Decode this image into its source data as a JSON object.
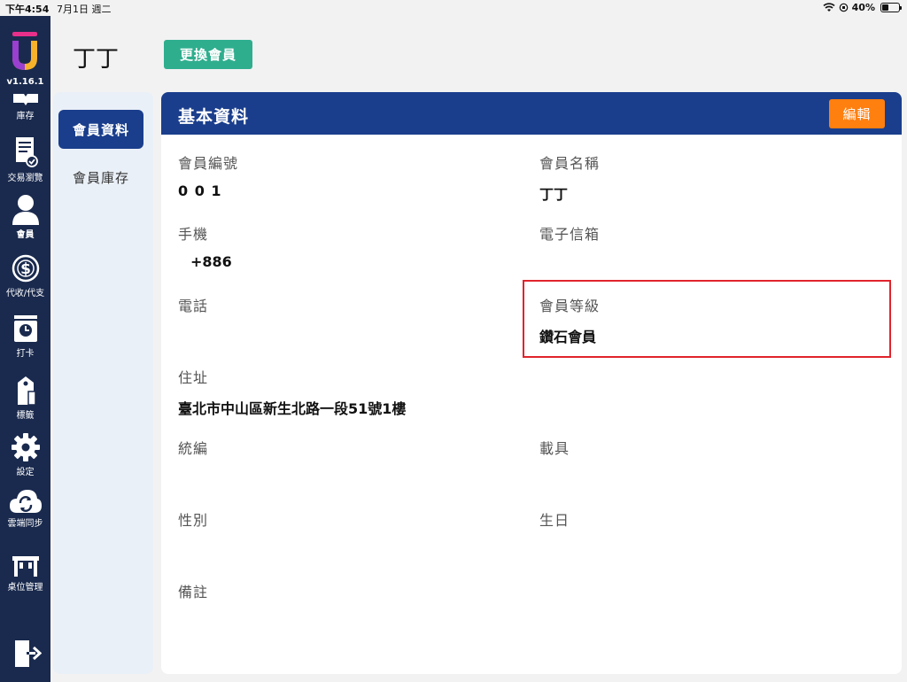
{
  "status_bar": {
    "time": "下午4:54",
    "date": "7月1日 週二",
    "battery": "40%",
    "battery_level": 0.4
  },
  "app": {
    "version": "v1.16.1"
  },
  "left_nav": {
    "items": [
      {
        "label": "庫存",
        "icon": "inventory-icon"
      },
      {
        "label": "交易瀏覽",
        "icon": "transactions-icon"
      },
      {
        "label": "會員",
        "icon": "member-icon"
      },
      {
        "label": "代收/代支",
        "icon": "dollar-icon"
      },
      {
        "label": "打卡",
        "icon": "clock-in-icon"
      },
      {
        "label": "標籤",
        "icon": "label-icon"
      },
      {
        "label": "設定",
        "icon": "gear-icon"
      },
      {
        "label": "雲端同步",
        "icon": "cloud-sync-icon"
      },
      {
        "label": "桌位管理",
        "icon": "table-icon"
      }
    ],
    "logout_icon": "logout-icon"
  },
  "header": {
    "member_name": "丁丁",
    "switch_button": "更換會員"
  },
  "sub_nav": {
    "items": [
      {
        "label": "會員資料",
        "active": true
      },
      {
        "label": "會員庫存",
        "active": false
      }
    ]
  },
  "card": {
    "title": "基本資料",
    "edit_button": "編輯",
    "fields": {
      "member_id": {
        "label": "會員編號",
        "value": "0 0 1"
      },
      "member_name": {
        "label": "會員名稱",
        "value": "丁丁"
      },
      "mobile": {
        "label": "手機",
        "value": "+886"
      },
      "email": {
        "label": "電子信箱",
        "value": ""
      },
      "phone": {
        "label": "電話",
        "value": ""
      },
      "member_level": {
        "label": "會員等級",
        "value": "鑽石會員"
      },
      "address": {
        "label": "住址",
        "value": "臺北市中山區新生北路一段51號1樓"
      },
      "tax_id": {
        "label": "統編",
        "value": ""
      },
      "carrier": {
        "label": "載具",
        "value": ""
      },
      "gender": {
        "label": "性別",
        "value": ""
      },
      "birthday": {
        "label": "生日",
        "value": ""
      },
      "note": {
        "label": "備註",
        "value": ""
      }
    }
  },
  "colors": {
    "nav_bg": "#1a2a4e",
    "primary": "#1a3e8c",
    "switch_button": "#2fae8e",
    "edit_button": "#ff7f0f",
    "highlight": "#e0242c"
  }
}
